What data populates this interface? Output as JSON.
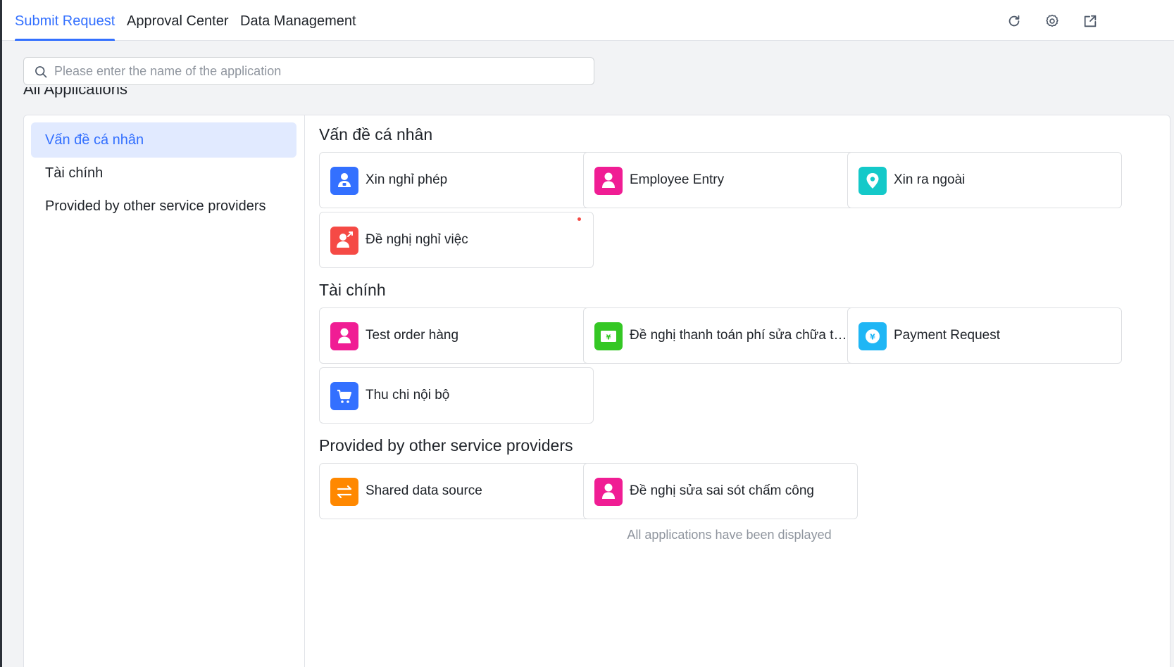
{
  "tabs": [
    {
      "label": "Submit Request",
      "active": true
    },
    {
      "label": "Approval Center",
      "active": false
    },
    {
      "label": "Data Management",
      "active": false
    }
  ],
  "header_icons": [
    "refresh-icon",
    "gear-icon",
    "open-window-icon"
  ],
  "search": {
    "placeholder": "Please enter the name of the application",
    "value": ""
  },
  "section_label": "All Applications",
  "sidebar": {
    "items": [
      {
        "label": "Vấn đề cá nhân",
        "active": true
      },
      {
        "label": "Tài chính",
        "active": false
      },
      {
        "label": "Provided by other service providers",
        "active": false
      }
    ]
  },
  "groups": [
    {
      "title": "Vấn đề cá nhân",
      "apps": [
        {
          "name": "Xin nghỉ phép",
          "icon": "person-badge-icon",
          "color": "#3370ff"
        },
        {
          "name": "Employee Entry",
          "icon": "person-icon",
          "color": "#f01d94"
        },
        {
          "name": "Xin ra ngoài",
          "icon": "location-pin-icon",
          "color": "#14c9c9"
        },
        {
          "name": "Đề nghị nghỉ việc",
          "icon": "person-exit-icon",
          "color": "#f54a45",
          "badge": true
        }
      ]
    },
    {
      "title": "Tài chính",
      "apps": [
        {
          "name": "Test order hàng",
          "icon": "person-icon",
          "color": "#f01d94"
        },
        {
          "name": "Đề nghị thanh toán phí sửa chữa tòa nhà",
          "icon": "money-bill-icon",
          "color": "#34c724"
        },
        {
          "name": "Payment Request",
          "icon": "yen-coin-icon",
          "color": "#1fb6f5"
        },
        {
          "name": "Thu chi nội bộ",
          "icon": "shopping-cart-icon",
          "color": "#3370ff"
        }
      ]
    },
    {
      "title": "Provided by other service providers",
      "apps": [
        {
          "name": "Shared data source",
          "icon": "swap-arrows-icon",
          "color": "#ff8800"
        },
        {
          "name": "Đề nghị sửa sai sót chấm công",
          "icon": "person-icon",
          "color": "#f01d94"
        }
      ]
    }
  ],
  "footer_note": "All applications have been displayed",
  "colors": {
    "accent": "#3370ff",
    "accent_light": "#e1eaff",
    "text": "#1f2329",
    "muted": "#8f959e"
  }
}
